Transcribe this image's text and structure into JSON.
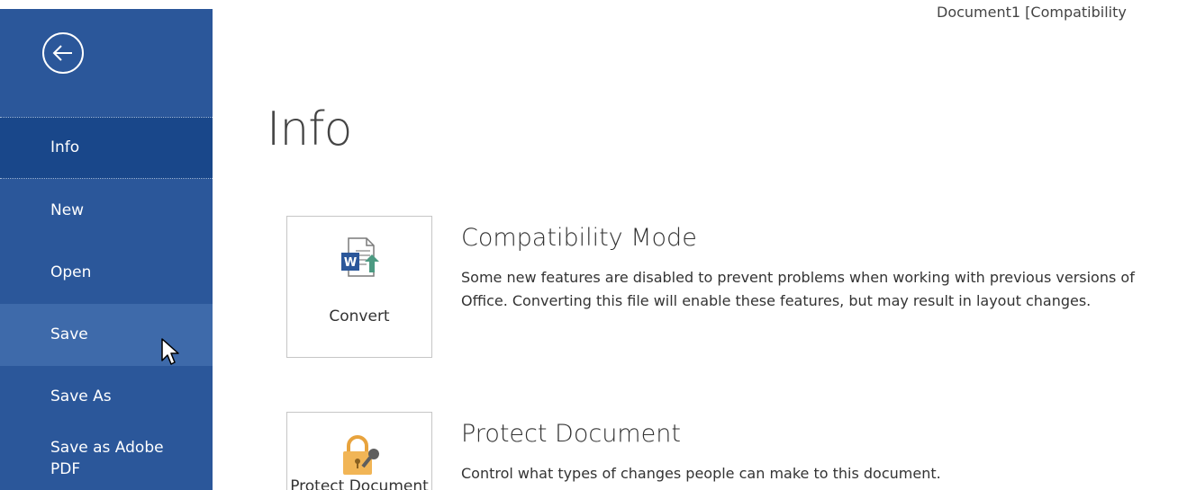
{
  "window": {
    "document_title": "Document1 [Compatibility"
  },
  "sidebar": {
    "back_icon": "back-arrow-circle-icon",
    "items": [
      {
        "label": "Info",
        "state": "selected"
      },
      {
        "label": "New"
      },
      {
        "label": "Open"
      },
      {
        "label": "Save",
        "state": "hover"
      },
      {
        "label": "Save As"
      },
      {
        "label": "Save as Adobe PDF"
      }
    ],
    "background_color": "#2b579a",
    "selected_color": "#19478a",
    "hover_color": "#3e6aaa"
  },
  "main": {
    "title": "Info",
    "sections": [
      {
        "tile_label": "Convert",
        "tile_icon": "word-document-convert-icon",
        "heading": "Compatibility Mode",
        "description": "Some new features are disabled to prevent problems when working with previous versions of Office. Converting this file will enable these features, but may result in layout changes."
      },
      {
        "tile_label": "Protect Document",
        "tile_icon": "lock-key-icon",
        "heading": "Protect Document",
        "description": "Control what types of changes people can make to this document."
      }
    ]
  }
}
